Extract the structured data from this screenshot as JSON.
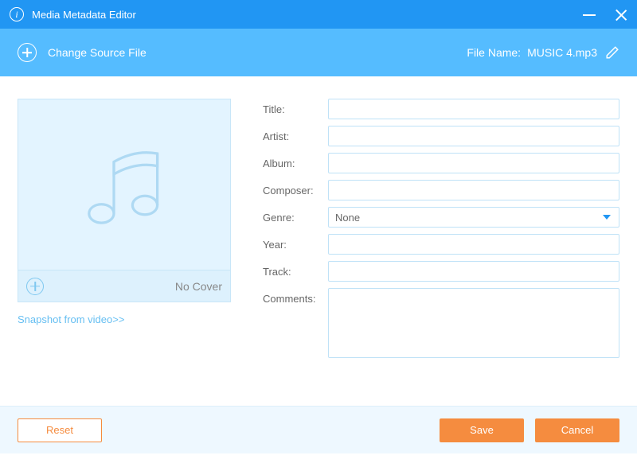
{
  "window": {
    "title": "Media Metadata Editor"
  },
  "toolbar": {
    "change_source_label": "Change Source File",
    "file_name_label": "File Name:",
    "file_name_value": "MUSIC 4.mp3"
  },
  "cover": {
    "no_cover_label": "No Cover",
    "snapshot_link": "Snapshot from video>>"
  },
  "form": {
    "title": {
      "label": "Title:",
      "value": ""
    },
    "artist": {
      "label": "Artist:",
      "value": ""
    },
    "album": {
      "label": "Album:",
      "value": ""
    },
    "composer": {
      "label": "Composer:",
      "value": ""
    },
    "genre": {
      "label": "Genre:",
      "value": "None"
    },
    "year": {
      "label": "Year:",
      "value": ""
    },
    "track": {
      "label": "Track:",
      "value": ""
    },
    "comments": {
      "label": "Comments:",
      "value": ""
    }
  },
  "actions": {
    "reset": "Reset",
    "save": "Save",
    "cancel": "Cancel"
  }
}
